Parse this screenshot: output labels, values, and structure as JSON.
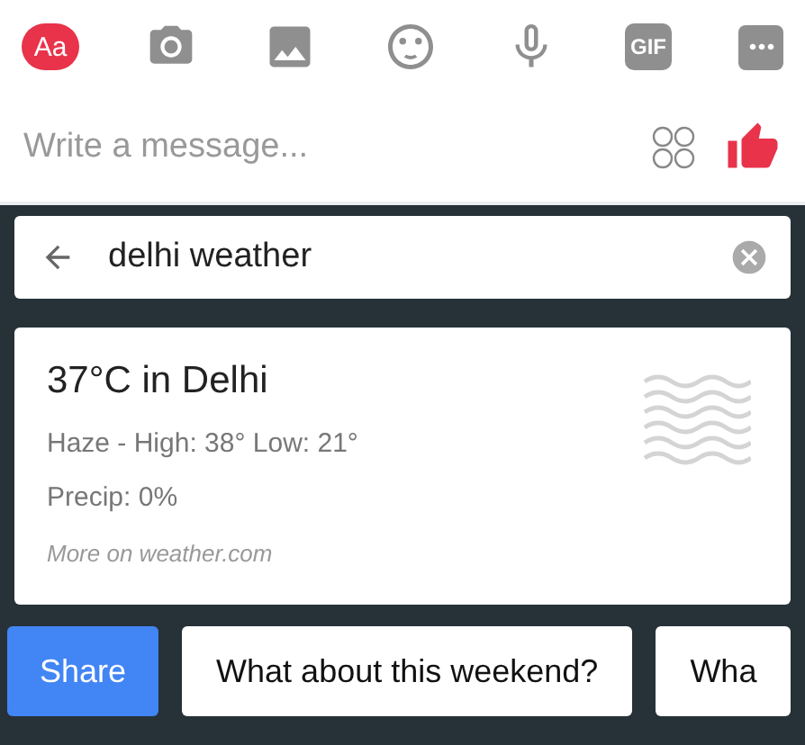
{
  "toolbar": [
    {
      "kind": "label",
      "text": "Aa",
      "color": "#e8334a"
    },
    {
      "kind": "camera"
    },
    {
      "kind": "image"
    },
    {
      "kind": "emoji"
    },
    {
      "kind": "mic"
    },
    {
      "kind": "label",
      "text": "GIF",
      "color": "#8f8f8f"
    },
    {
      "kind": "more"
    }
  ],
  "composer": {
    "placeholder": "Write a message..."
  },
  "search": {
    "value": "delhi weather"
  },
  "weather_card": {
    "title": "37°C in Delhi",
    "summary": "Haze - High: 38° Low: 21°",
    "precip": "Precip: 0%",
    "source": "More on weather.com"
  },
  "suggestions": [
    {
      "kind": "primary",
      "label": "Share"
    },
    {
      "kind": "chip",
      "label": "What about this weekend?"
    },
    {
      "kind": "chip",
      "label": "Wha"
    }
  ]
}
